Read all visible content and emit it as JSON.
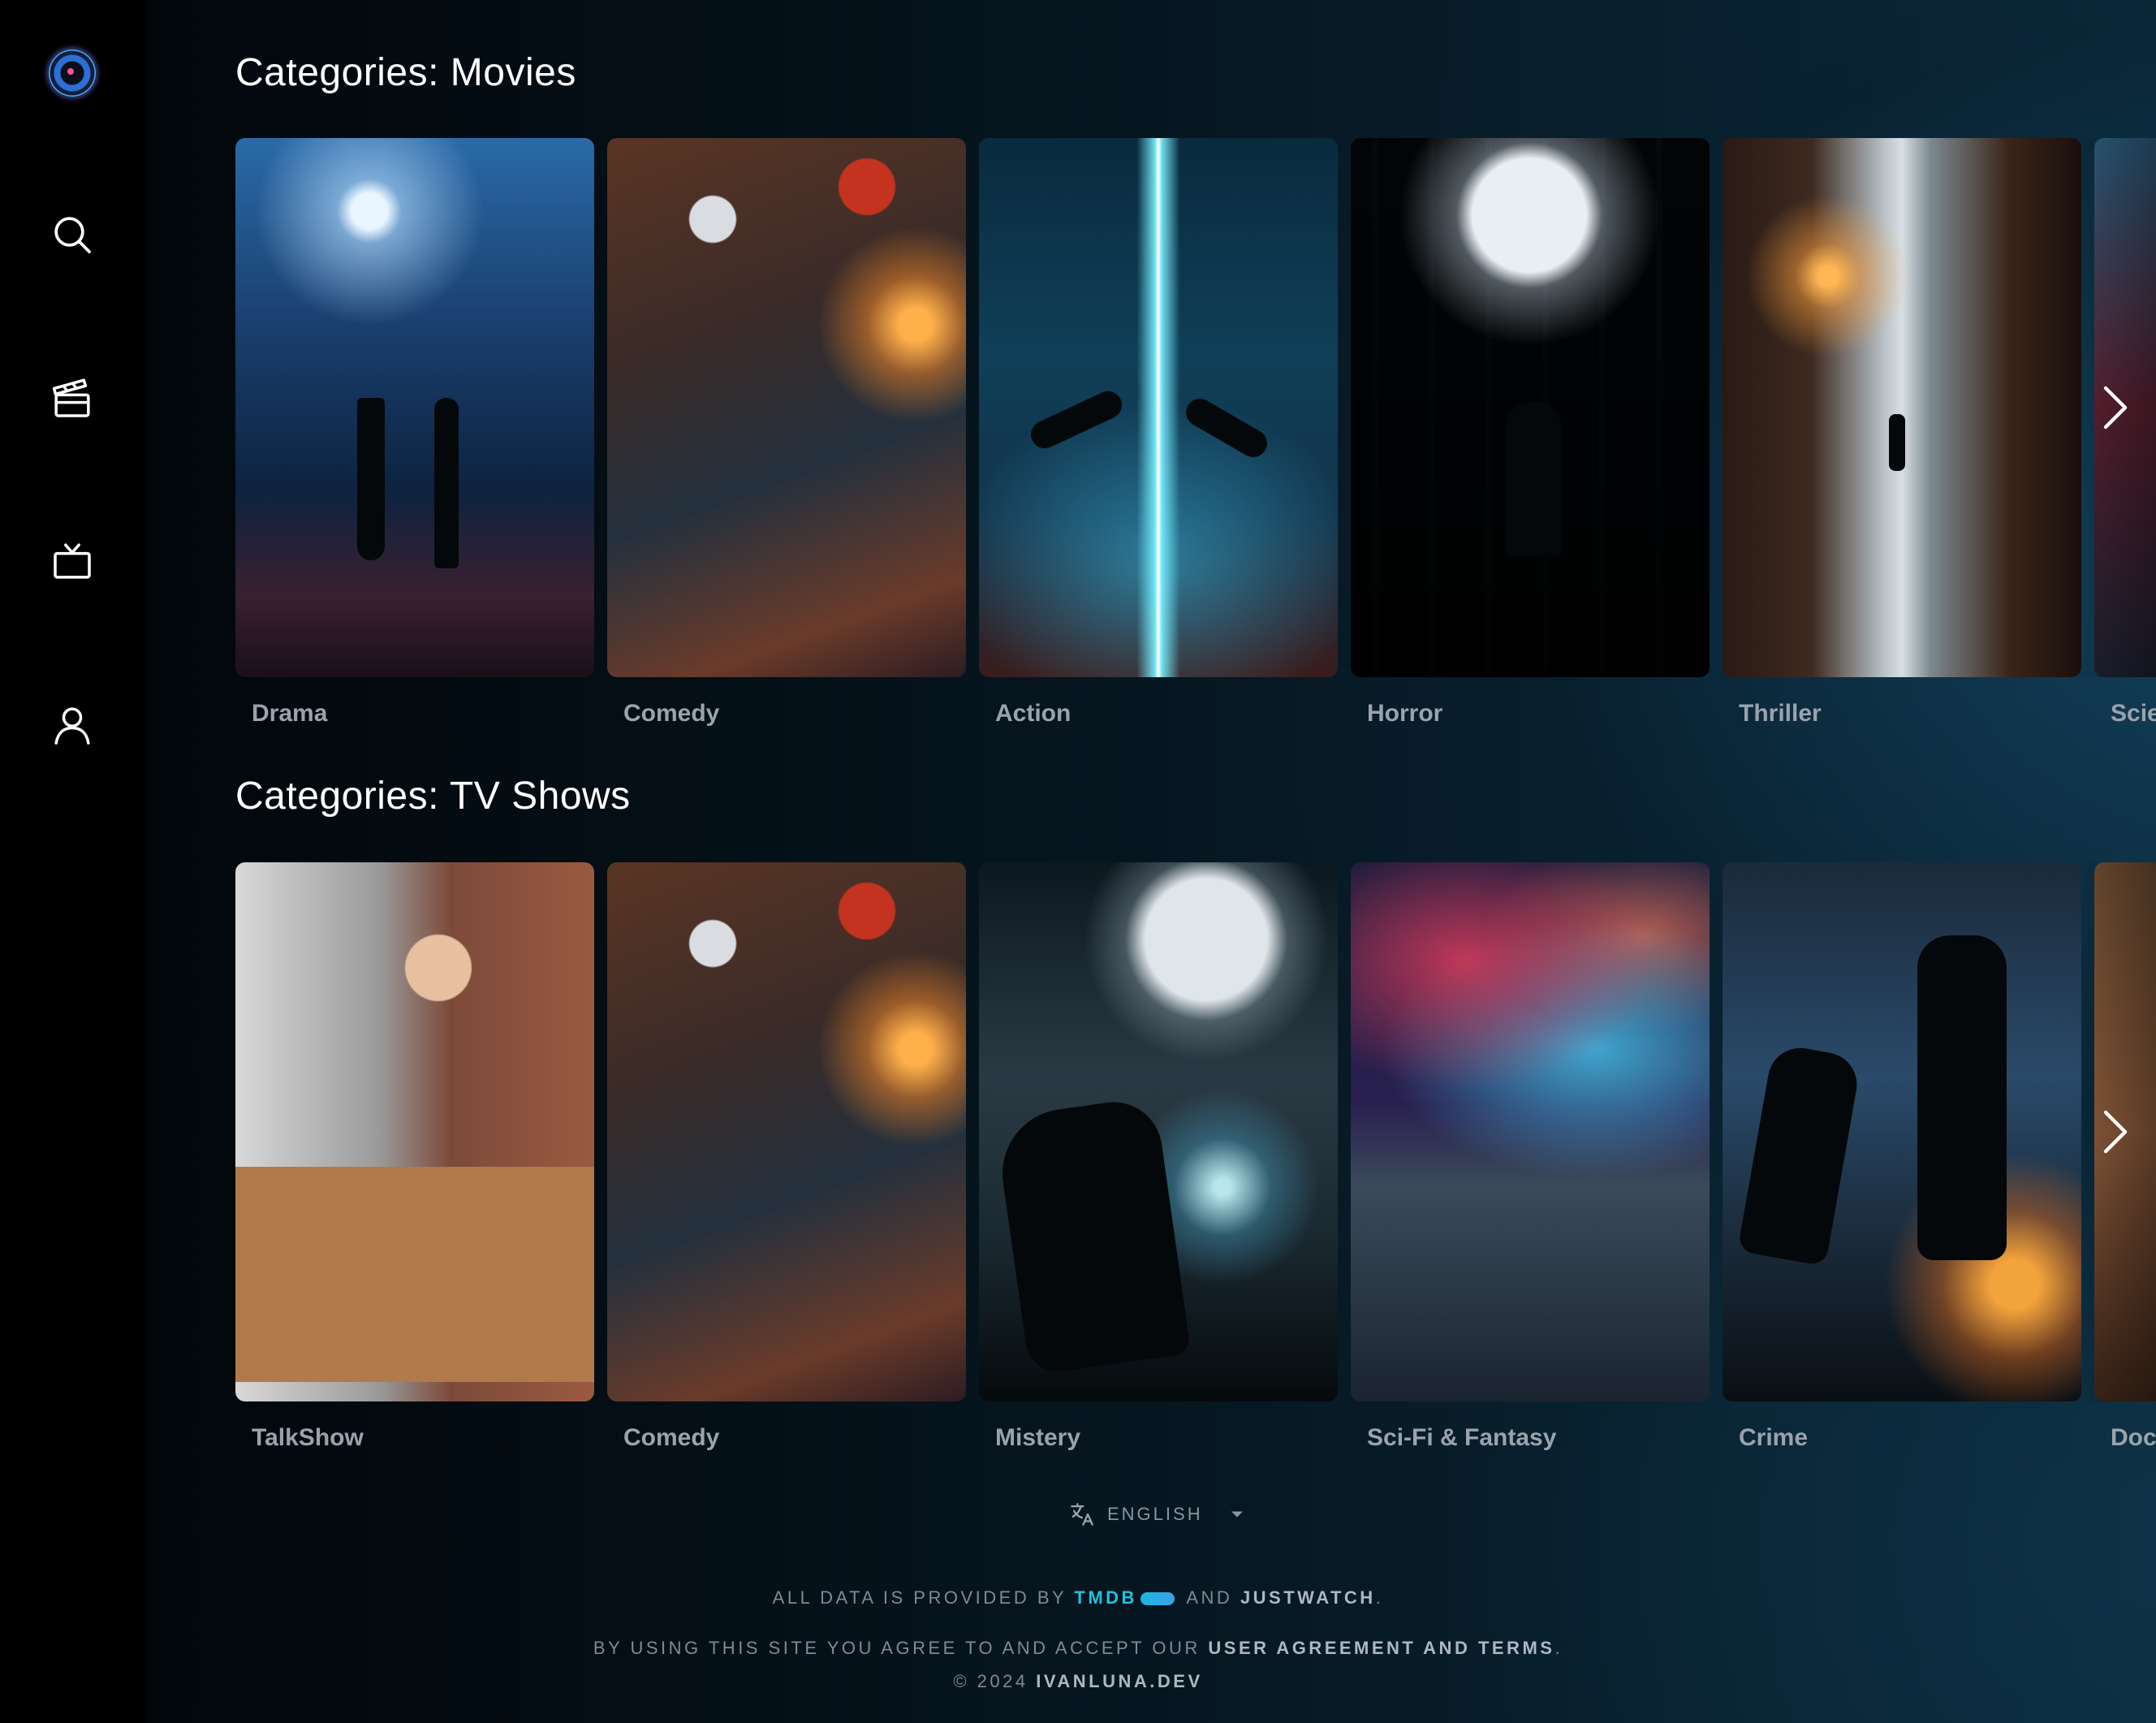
{
  "sidebar": {
    "logo": "app-logo",
    "items": [
      {
        "name": "search",
        "icon": "search-icon"
      },
      {
        "name": "movies",
        "icon": "clapperboard-icon"
      },
      {
        "name": "tv",
        "icon": "tv-icon"
      },
      {
        "name": "profile",
        "icon": "user-icon"
      }
    ]
  },
  "movies": {
    "title": "Categories: Movies",
    "items": [
      {
        "label": "Drama"
      },
      {
        "label": "Comedy"
      },
      {
        "label": "Action"
      },
      {
        "label": "Horror"
      },
      {
        "label": "Thriller"
      },
      {
        "label": "Scie"
      }
    ]
  },
  "tv": {
    "title": "Categories: TV Shows",
    "items": [
      {
        "label": "TalkShow"
      },
      {
        "label": "Comedy"
      },
      {
        "label": "Mistery"
      },
      {
        "label": "Sci-Fi & Fantasy"
      },
      {
        "label": "Crime"
      },
      {
        "label": "Doc"
      }
    ]
  },
  "footer": {
    "language": "ENGLISH",
    "data_prefix": "ALL DATA IS PROVIDED BY",
    "tmdb": "TMDB",
    "and": "AND",
    "justwatch": "JUSTWATCH",
    "dot": ".",
    "agreement_prefix": "BY USING THIS SITE YOU AGREE TO AND ACCEPT OUR",
    "agreement_link": "USER AGREEMENT AND TERMS",
    "copyright_prefix": "© 2024",
    "copyright_link": "IVANLUNA.DEV"
  },
  "colors": {
    "accent": "#22c1dd",
    "label": "#9aa3ad",
    "footer_text": "#7f8a94"
  }
}
